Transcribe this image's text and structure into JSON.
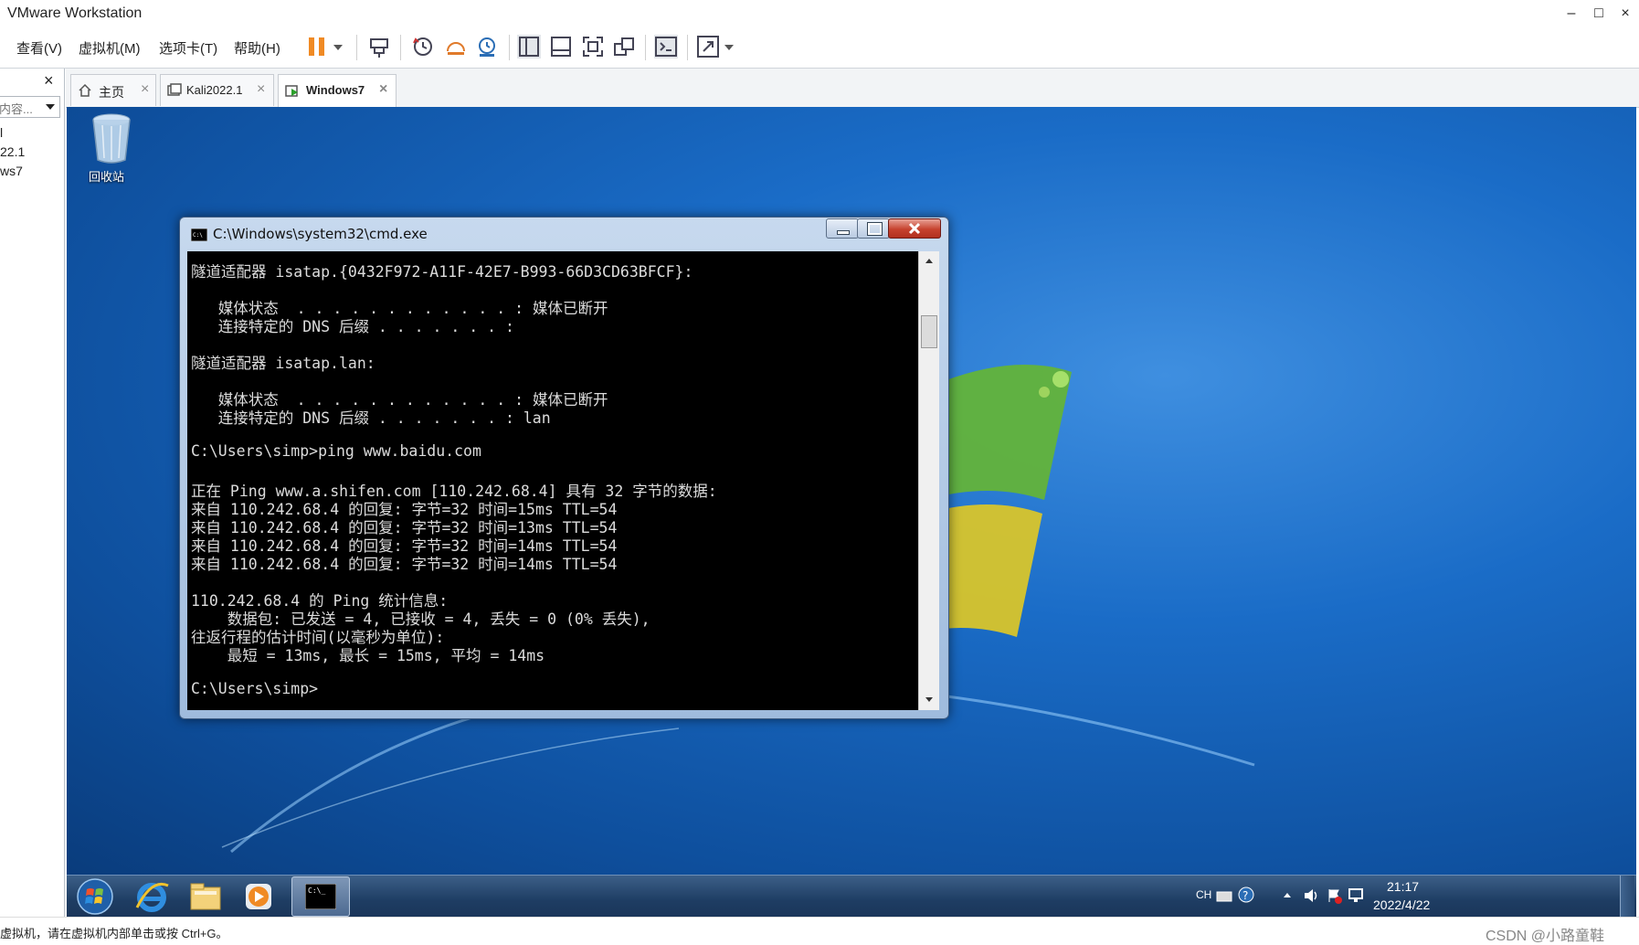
{
  "app": {
    "title": "VMware Workstation",
    "window_controls": {
      "minimize": "–",
      "maximize": "□",
      "close": "×"
    }
  },
  "menu": [
    "查看(V)",
    "虚拟机(M)",
    "选项卡(T)",
    "帮助(H)"
  ],
  "toolbar_icons": [
    "pause-icon",
    "dropdown-icon",
    "send-keys-icon",
    "snapshot-icon",
    "revert-snapshot-icon",
    "snapshot-manager-icon",
    "library-view-icon",
    "console-view-icon",
    "fullscreen-icon",
    "unity-icon",
    "terminal-icon",
    "stretch-icon",
    "stretch-dropdown-icon"
  ],
  "sidebar": {
    "close": "×",
    "search_placeholder": "内容...",
    "items": [
      "l",
      "22.1",
      "ws7"
    ]
  },
  "tabs": [
    {
      "label": "主页",
      "icon": "home-icon",
      "close": "×"
    },
    {
      "label": "Kali2022.1",
      "icon": "vm-icon",
      "close": "×"
    },
    {
      "label": "Windows7",
      "icon": "vm-running-icon",
      "close": "×",
      "active": true
    }
  ],
  "desktop": {
    "recycle_bin_label": "回收站"
  },
  "cmd": {
    "title": "C:\\Windows\\system32\\cmd.exe",
    "lines": [
      "隧道适配器 isatap.{0432F972-A11F-42E7-B993-66D3CD63BFCF}:",
      "",
      "   媒体状态  . . . . . . . . . . . . : 媒体已断开",
      "   连接特定的 DNS 后缀 . . . . . . . :",
      "",
      "隧道适配器 isatap.lan:",
      "",
      "   媒体状态  . . . . . . . . . . . . : 媒体已断开",
      "   连接特定的 DNS 后缀 . . . . . . . : lan",
      "",
      "C:\\Users\\simp>ping www.baidu.com",
      "",
      "正在 Ping www.a.shifen.com [110.242.68.4] 具有 32 字节的数据:",
      "来自 110.242.68.4 的回复: 字节=32 时间=15ms TTL=54",
      "来自 110.242.68.4 的回复: 字节=32 时间=13ms TTL=54",
      "来自 110.242.68.4 的回复: 字节=32 时间=14ms TTL=54",
      "来自 110.242.68.4 的回复: 字节=32 时间=14ms TTL=54",
      "",
      "110.242.68.4 的 Ping 统计信息:",
      "    数据包: 已发送 = 4, 已接收 = 4, 丢失 = 0 (0% 丢失),",
      "往返行程的估计时间(以毫秒为单位):",
      "    最短 = 13ms, 最长 = 15ms, 平均 = 14ms",
      "",
      "C:\\Users\\simp>"
    ]
  },
  "taskbar": {
    "items": [
      "start-orb-icon",
      "internet-explorer-icon",
      "file-explorer-icon",
      "media-player-icon",
      "cmd-taskbar-icon"
    ],
    "tray": {
      "lang": "CH",
      "time": "21:17",
      "date": "2022/4/22"
    }
  },
  "status": {
    "text": "虚拟机，请在虚拟机内部单击或按 Ctrl+G。",
    "watermark": "CSDN @小路童鞋"
  },
  "colors": {
    "desktop": "#1a6cc7",
    "console_bg": "#000000",
    "console_fg": "#dcdcdc",
    "pause_orange": "#f08a24"
  }
}
